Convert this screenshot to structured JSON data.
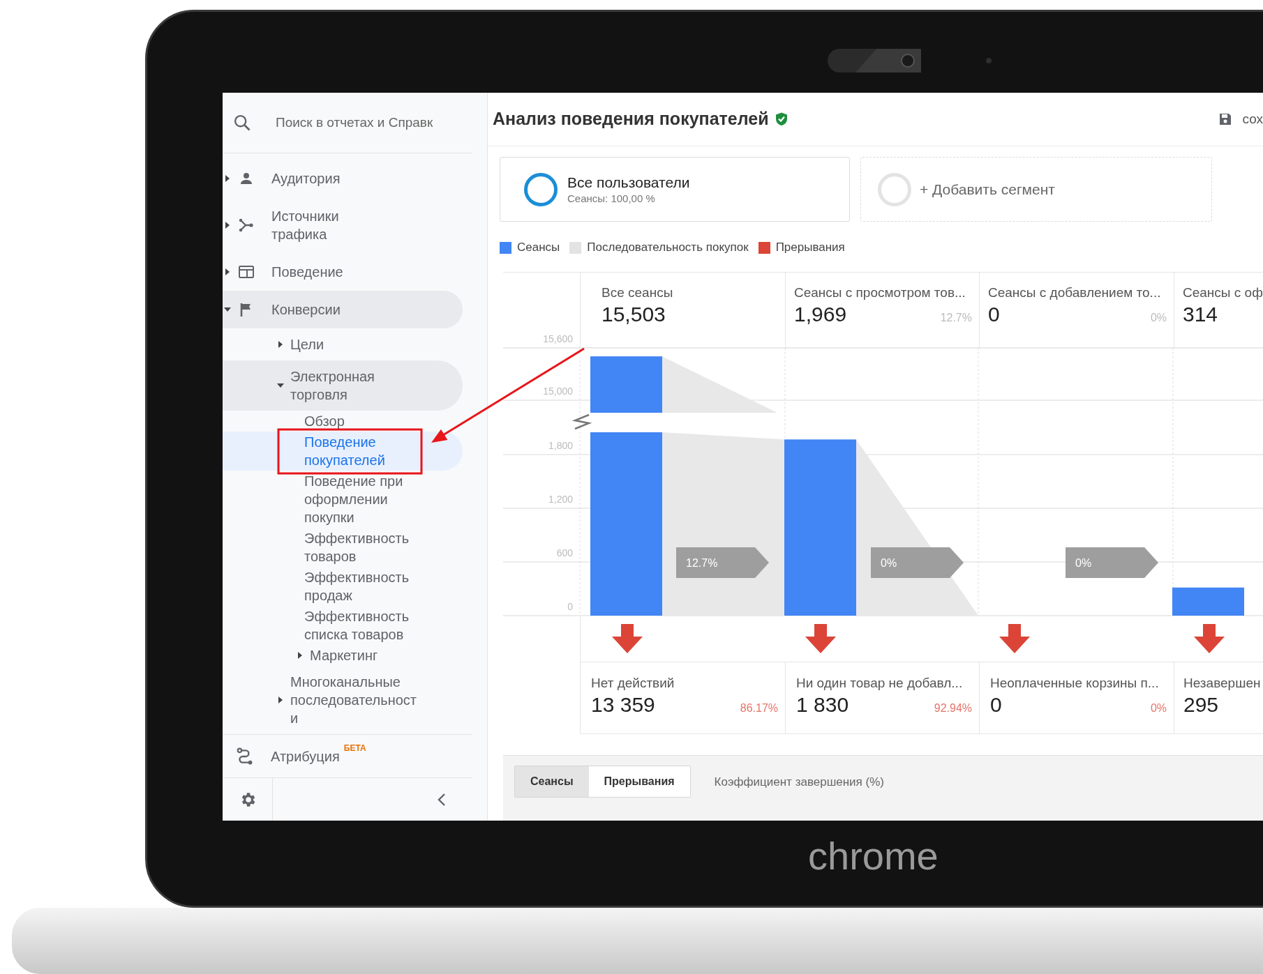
{
  "device": {
    "label": "chrome"
  },
  "sidebar": {
    "search": {
      "placeholder": "Поиск в отчетах и Справк"
    },
    "items": [
      {
        "label": "Аудитория",
        "expanded": false,
        "selected": false
      },
      {
        "label": "Источники трафика",
        "expanded": false,
        "selected": false
      },
      {
        "label": "Поведение",
        "expanded": false,
        "selected": false
      },
      {
        "label": "Конверсии",
        "expanded": true,
        "selected": false,
        "children": [
          {
            "label": "Цели",
            "expanded": false,
            "selected": false
          },
          {
            "label": "Электронная торговля",
            "expanded": true,
            "selected": false,
            "children": [
              {
                "label": "Обзор",
                "selected": false
              },
              {
                "label": "Поведение покупателей",
                "selected": true
              },
              {
                "label": "Поведение при оформлении покупки",
                "selected": false
              },
              {
                "label": "Эффективность товаров",
                "selected": false
              },
              {
                "label": "Эффективность продаж",
                "selected": false
              },
              {
                "label": "Эффективность списка товаров",
                "selected": false
              },
              {
                "label": "Маркетинг",
                "expanded": false,
                "selected": false
              }
            ]
          },
          {
            "label": "Многоканальные последовательности",
            "expanded": false,
            "selected": false
          }
        ]
      }
    ],
    "attribution": {
      "label": "Атрибуция",
      "badge": "БЕТА"
    }
  },
  "header": {
    "title": "Анализ поведения покупателей",
    "verified": true,
    "save_button": "сох"
  },
  "segments": [
    {
      "kind": "active",
      "title": "Все пользователи",
      "subtitle": "Сеансы: 100,00 %"
    },
    {
      "kind": "add",
      "title": "+ Добавить сегмент"
    }
  ],
  "legend": [
    {
      "label": "Сеансы",
      "color": "#4285f4"
    },
    {
      "label": "Последовательность покупок",
      "color": "#e3e3e3"
    },
    {
      "label": "Прерывания",
      "color": "#db4437"
    }
  ],
  "funnel": {
    "steps": [
      {
        "label": "Все сеансы",
        "value": "15,503"
      },
      {
        "label": "Сеансы с просмотром тов...",
        "value": "1,969",
        "percent": "12.7%"
      },
      {
        "label": "Сеансы с добавлением то...",
        "value": "0",
        "percent": "0%"
      },
      {
        "label": "Сеансы с оф",
        "value": "314"
      }
    ],
    "axis_labels": [
      "15,600",
      "15,000",
      "1,800",
      "1,200",
      "600",
      "0"
    ],
    "conversion_tags": [
      "12.7%",
      "0%",
      "0%"
    ],
    "drop_offs": [
      {
        "label": "Нет действий",
        "value": "13 359",
        "percent": "86.17%"
      },
      {
        "label": "Ни один товар не добавл...",
        "value": "1 830",
        "percent": "92.94%"
      },
      {
        "label": "Неоплаченные корзины п...",
        "value": "0",
        "percent": "0%"
      },
      {
        "label": "Незавершен",
        "value": "295"
      }
    ]
  },
  "bottom_tabs": [
    {
      "label": "Сеансы",
      "selected": true
    },
    {
      "label": "Прерывания",
      "selected": false
    }
  ],
  "metric_label": "Коэффициент завершения (%)"
}
